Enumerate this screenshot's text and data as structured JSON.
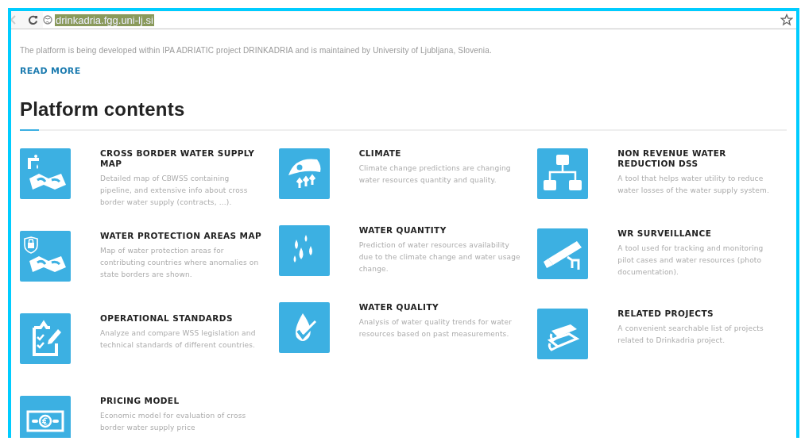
{
  "address_bar": {
    "url": "drinkadria.fgg.uni-lj.si"
  },
  "intro": {
    "text": "The platform is being developed within IPA ADRIATIC project DRINKADRIA and is maintained by University of Ljubljana, Slovenia.",
    "link": "READ MORE"
  },
  "heading": "Platform contents",
  "columns": [
    {
      "items": [
        {
          "title": "CROSS BORDER WATER SUPPLY MAP",
          "description": "Detailed map of CBWSS containing pipeline, and extensive info about cross border water supply (contracts, ...)."
        },
        {
          "title": "WATER PROTECTION AREAS MAP",
          "description": "Map of water protection areas for contributing countries where anomalies on state borders are shown."
        },
        {
          "title": "OPERATIONAL STANDARDS",
          "description": "Analyze and compare WSS legislation and technical standards of different countries."
        },
        {
          "title": "PRICING MODEL",
          "description": "Economic model for evaluation of cross border water supply price"
        }
      ]
    },
    {
      "items": [
        {
          "title": "CLIMATE",
          "description": "Climate change predictions are changing water resources quantity and quality."
        },
        {
          "title": "WATER QUANTITY",
          "description": "Prediction of water resources availability due to the climate change and water usage change."
        },
        {
          "title": "WATER QUALITY",
          "description": "Analysis of water quality trends for water resources based on past measurements."
        }
      ]
    },
    {
      "items": [
        {
          "title": "NON REVENUE WATER REDUCTION DSS",
          "description": "A tool that helps water utility to reduce water losses of the water supply system."
        },
        {
          "title": "WR SURVEILLANCE",
          "description": "A tool used for tracking and monitoring pilot cases and water resources (photo documentation)."
        },
        {
          "title": "RELATED PROJECTS",
          "description": "A convenient searchable list of projects related to Drinkadria project."
        }
      ]
    }
  ]
}
